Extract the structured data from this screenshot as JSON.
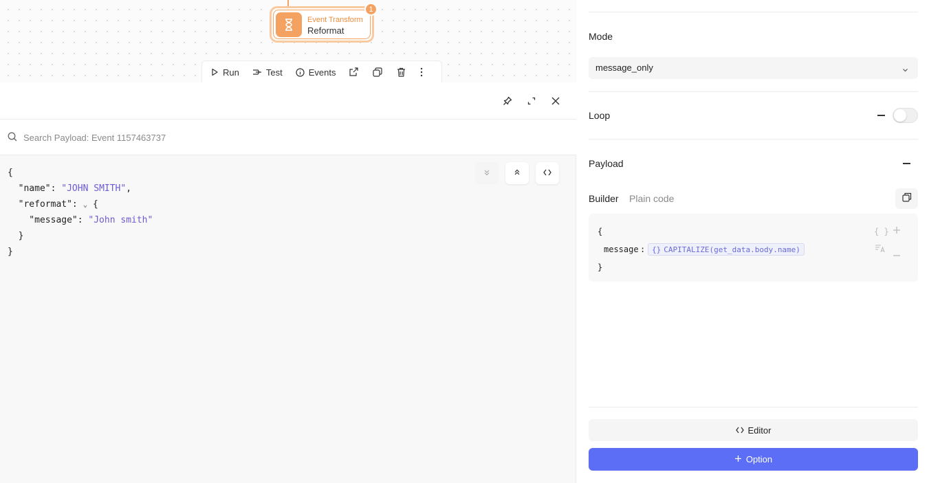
{
  "node": {
    "kind": "Event Transform",
    "name": "Reformat",
    "badge": "1"
  },
  "toolbar": {
    "run": "Run",
    "test": "Test",
    "events": "Events"
  },
  "search": {
    "placeholder": "Search Payload: Event 1157463737"
  },
  "payload_view": {
    "lines": [
      {
        "k": "{"
      },
      {
        "k": "  \"name\": ",
        "s": "\"JOHN SMITH\"",
        "t": ","
      },
      {
        "k": "  \"reformat\": ",
        "caret": "⌄",
        "t": " {"
      },
      {
        "k": "    \"message\": ",
        "s": "\"John smith\""
      },
      {
        "k": "  }"
      },
      {
        "k": "}"
      }
    ]
  },
  "side": {
    "mode_label": "Mode",
    "mode_value": "message_only",
    "loop_label": "Loop",
    "loop_enabled": false,
    "payload_label": "Payload",
    "tab_builder": "Builder",
    "tab_plain": "Plain code",
    "builder": {
      "open": "{",
      "key": "message",
      "colon": ":",
      "chip_icon": "{}",
      "expression": "CAPITALIZE(get_data.body.name)",
      "close": "}",
      "object_icon": "{ }"
    },
    "editor_button": "Editor",
    "option_button": "Option"
  },
  "colors": {
    "accent": "#5b6ef5",
    "node": "#f4a261",
    "string": "#6b5bd6"
  }
}
